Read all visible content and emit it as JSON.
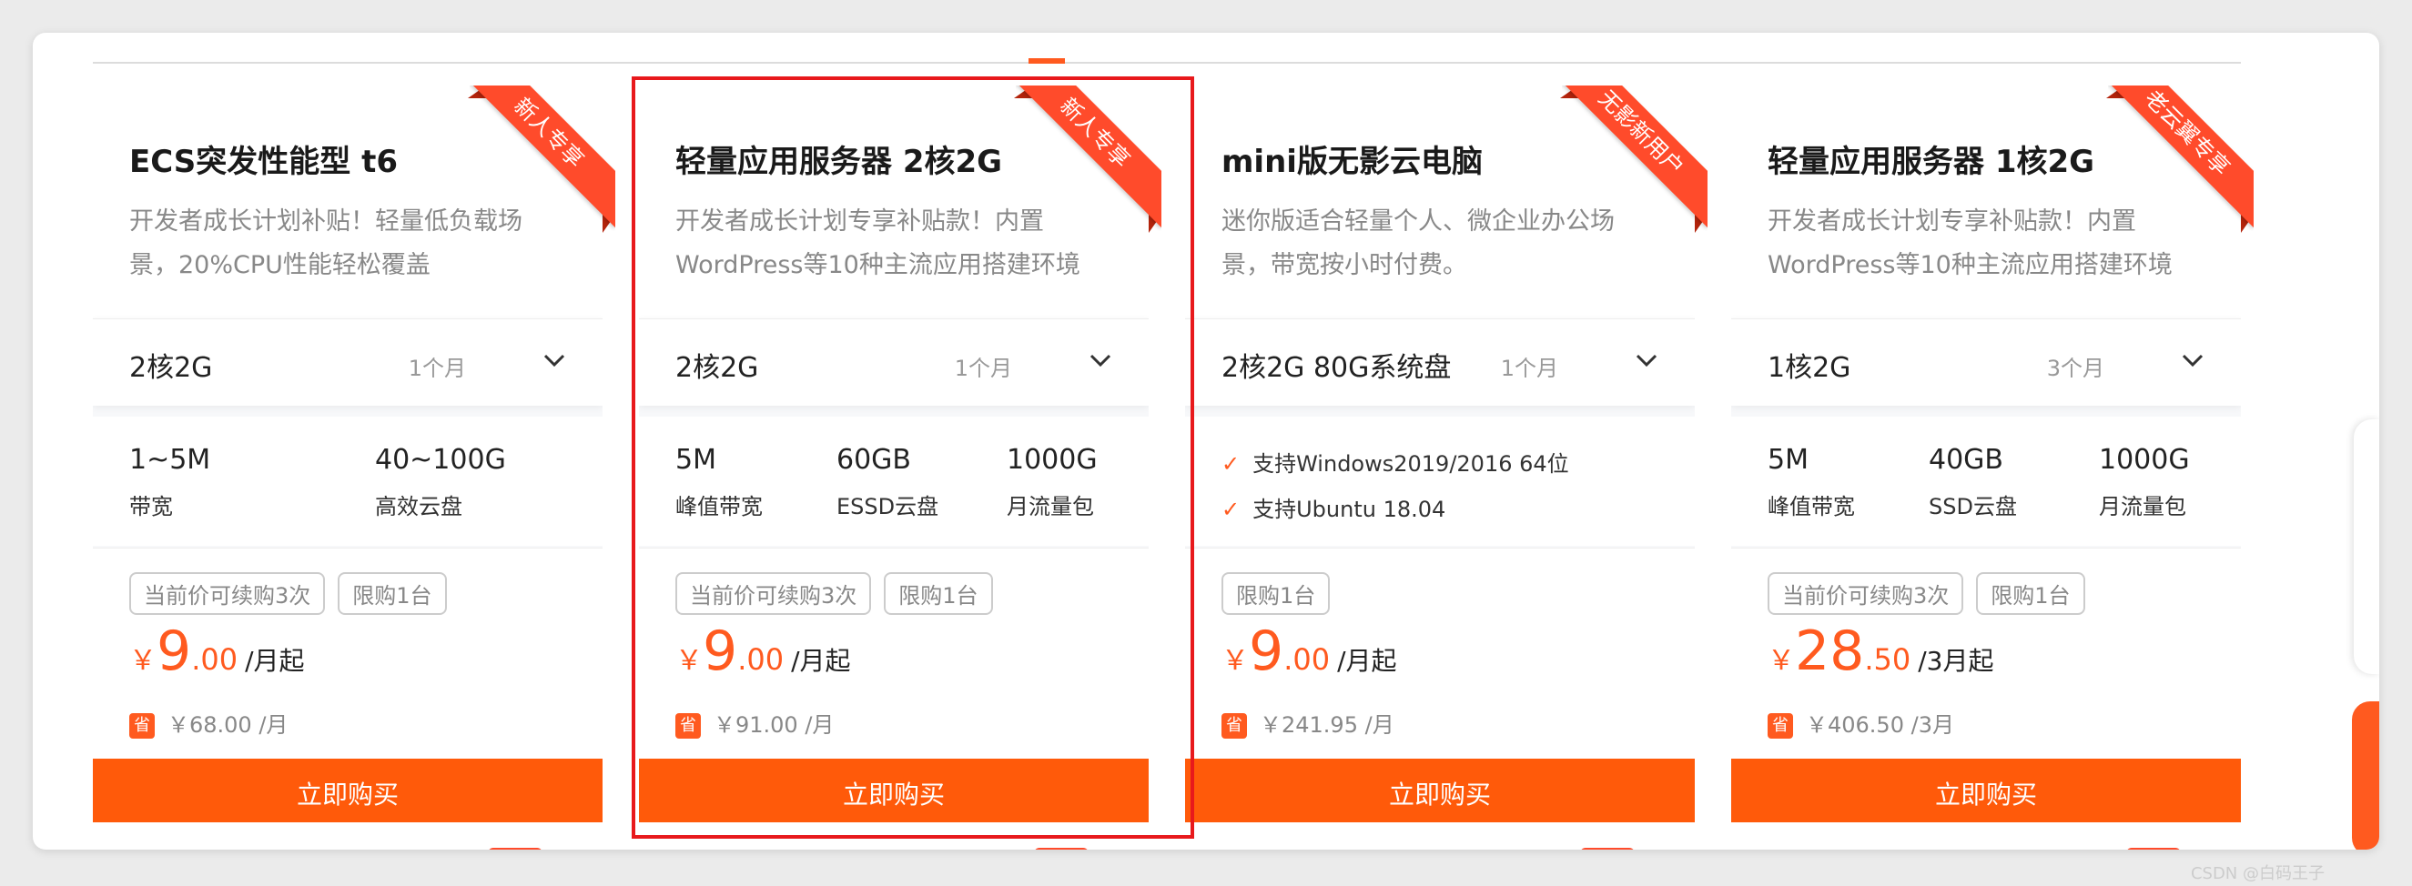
{
  "cards": [
    {
      "title": "ECS突发性能型 t6",
      "desc": "开发者成长计划补贴！轻量低负载场景，20%CPU性能轻松覆盖",
      "ribbon": "新人专享",
      "spec": "2核2G",
      "period": "1个月",
      "features": [
        {
          "value": "1~5M",
          "label": "带宽"
        },
        {
          "value": "40~100G",
          "label": "高效云盘"
        }
      ],
      "tags": [
        "当前价可续购3次",
        "限购1台"
      ],
      "price_symbol": "￥",
      "price_int": "9",
      "price_dec": ".00",
      "price_unit": "/月起",
      "save_badge": "省",
      "original_price": "￥68.00 /月",
      "buy_label": "立即购买"
    },
    {
      "title": "轻量应用服务器 2核2G",
      "desc": "开发者成长计划专享补贴款！内置WordPress等10种主流应用搭建环境",
      "ribbon": "新人专享",
      "spec": "2核2G",
      "period": "1个月",
      "features": [
        {
          "value": "5M",
          "label": "峰值带宽"
        },
        {
          "value": "60GB",
          "label": "ESSD云盘"
        },
        {
          "value": "1000G",
          "label": "月流量包"
        }
      ],
      "tags": [
        "当前价可续购3次",
        "限购1台"
      ],
      "price_symbol": "￥",
      "price_int": "9",
      "price_dec": ".00",
      "price_unit": "/月起",
      "save_badge": "省",
      "original_price": "￥91.00 /月",
      "buy_label": "立即购买"
    },
    {
      "title": "mini版无影云电脑",
      "desc": "迷你版适合轻量个人、微企业办公场景，带宽按小时付费。",
      "ribbon": "无影新用户",
      "spec": "2核2G 80G系统盘",
      "period": "1个月",
      "checks": [
        "支持Windows2019/2016 64位",
        "支持Ubuntu 18.04"
      ],
      "tags": [
        "限购1台"
      ],
      "price_symbol": "￥",
      "price_int": "9",
      "price_dec": ".00",
      "price_unit": "/月起",
      "save_badge": "省",
      "original_price": "￥241.95 /月",
      "buy_label": "立即购买"
    },
    {
      "title": "轻量应用服务器 1核2G",
      "desc": "开发者成长计划专享补贴款！内置WordPress等10种主流应用搭建环境",
      "ribbon": "老云翼专享",
      "spec": "1核2G",
      "period": "3个月",
      "features": [
        {
          "value": "5M",
          "label": "峰值带宽"
        },
        {
          "value": "40GB",
          "label": "SSD云盘"
        },
        {
          "value": "1000G",
          "label": "月流量包"
        }
      ],
      "tags": [
        "当前价可续购3次",
        "限购1台"
      ],
      "price_symbol": "￥",
      "price_int": "28",
      "price_dec": ".50",
      "price_unit": "/3月起",
      "save_badge": "省",
      "original_price": "￥406.50 /3月",
      "buy_label": "立即购买"
    }
  ],
  "watermark": "CSDN @白码王子",
  "colors": {
    "accent": "#ff5a0a",
    "ribbon": "#ff4b2b",
    "highlight": "#e8191c"
  }
}
